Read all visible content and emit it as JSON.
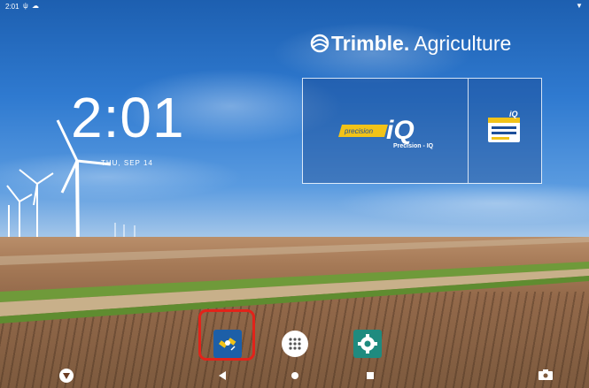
{
  "status_bar": {
    "time": "2:01"
  },
  "brand": {
    "name": "Trimble",
    "suffix": "Agriculture"
  },
  "clock": {
    "time": "2:01",
    "date": "THU, SEP 14"
  },
  "tiles": [
    {
      "name": "Precision - IQ",
      "badge": "precision",
      "logo": "iQ"
    },
    {
      "name": "iQ",
      "logo": "iQ"
    }
  ],
  "dock": [
    {
      "icon": "satellite-app-icon",
      "highlighted": true
    },
    {
      "icon": "app-drawer-icon"
    },
    {
      "icon": "settings-gear-icon"
    }
  ],
  "nav": [
    "back-icon",
    "home-icon",
    "recents-icon"
  ],
  "colors": {
    "highlight": "#e2231a",
    "settings": "#1f8b7f",
    "app": "#1d5fa8"
  }
}
